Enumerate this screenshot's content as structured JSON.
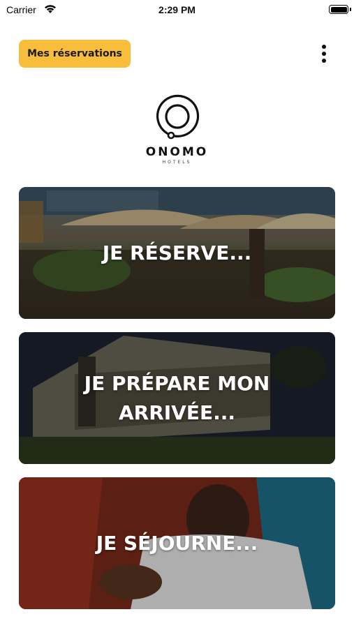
{
  "status_bar": {
    "carrier": "Carrier",
    "time": "2:29 PM",
    "wifi_icon": "wifi-icon",
    "battery_icon": "battery-icon"
  },
  "header": {
    "reservations_label": "Mes réservations",
    "menu_icon": "more-vertical-icon",
    "accent_color": "#f8bd3a"
  },
  "logo": {
    "name": "ONOMO",
    "subtitle": "HOTELS"
  },
  "cards": [
    {
      "title": "JE RÉSERVE..."
    },
    {
      "title": "JE PRÉPARE MON\nARRIVÉE..."
    },
    {
      "title": "JE SÉJOURNE..."
    }
  ]
}
